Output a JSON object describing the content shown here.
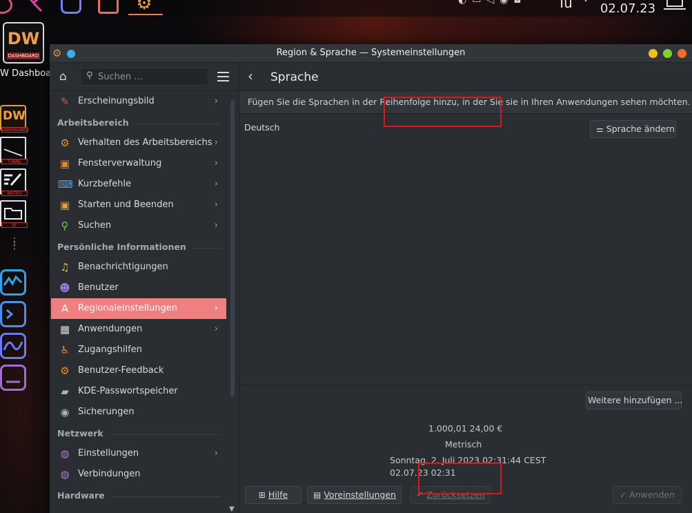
{
  "desktop": {
    "clock": "02.07.23",
    "tray_day": "Tu",
    "dw_widget": {
      "logo": "DW",
      "sub": "DASHBOARD",
      "label": "W Dashboa"
    },
    "dock": [
      {
        "name": "DW",
        "caption": "DASHBOARD"
      },
      {
        "name": "mail",
        "caption": "T-MAIL"
      },
      {
        "name": "notes",
        "caption": "NOTES"
      },
      {
        "name": "files",
        "caption": "SF"
      }
    ]
  },
  "window": {
    "title": "Region & Sprache — Systemeinstellungen"
  },
  "sidebar": {
    "search_placeholder": "Suchen ...",
    "items": [
      {
        "label": "Erscheinungsbild",
        "icon": "brush-icon",
        "color": "#e0563c",
        "chevron": true
      },
      {
        "section": "Arbeitsbereich"
      },
      {
        "label": "Verhalten des Arbeitsbereichs",
        "icon": "gear-icon",
        "color": "#e88a2a",
        "chevron": true
      },
      {
        "label": "Fensterverwaltung",
        "icon": "window-icon",
        "color": "#e88a2a",
        "chevron": true
      },
      {
        "label": "Kurzbefehle",
        "icon": "keyboard-icon",
        "color": "#4aa0e8",
        "chevron": true
      },
      {
        "label": "Starten und Beenden",
        "icon": "monitor-icon",
        "color": "#e8a02a",
        "chevron": true
      },
      {
        "label": "Suchen",
        "icon": "magnifier-icon",
        "color": "#7ad03a",
        "chevron": true
      },
      {
        "section": "Persönliche Informationen"
      },
      {
        "label": "Benachrichtigungen",
        "icon": "bell-icon",
        "color": "#f0c020",
        "chevron": false
      },
      {
        "label": "Benutzer",
        "icon": "users-icon",
        "color": "#9a7ae0",
        "chevron": false
      },
      {
        "label": "Regionaleinstellungen",
        "icon": "region-icon",
        "color": "#5ab0f0",
        "chevron": true,
        "active": true
      },
      {
        "label": "Anwendungen",
        "icon": "apps-grid-icon",
        "color": "#d6d8dc",
        "chevron": true
      },
      {
        "label": "Zugangshilfen",
        "icon": "accessibility-icon",
        "color": "#e88a2a",
        "chevron": false
      },
      {
        "label": "Benutzer-Feedback",
        "icon": "feedback-gear-icon",
        "color": "#e88a2a",
        "chevron": false
      },
      {
        "label": "KDE-Passwortspeicher",
        "icon": "wallet-icon",
        "color": "#b0b3b6",
        "chevron": false
      },
      {
        "label": "Sicherungen",
        "icon": "backup-icon",
        "color": "#b0b3b6",
        "chevron": false
      },
      {
        "section": "Netzwerk"
      },
      {
        "label": "Einstellungen",
        "icon": "globe-icon",
        "color": "#b07ae0",
        "chevron": true
      },
      {
        "label": "Verbindungen",
        "icon": "globe-icon",
        "color": "#b07ae0",
        "chevron": false
      },
      {
        "section": "Hardware"
      }
    ]
  },
  "main": {
    "title": "Sprache",
    "description": "Fügen Sie die Sprachen in der Reihenfolge hinzu, in der Sie sie in Ihren Anwendungen sehen möchten.",
    "language": "Deutsch",
    "change_language_label": "Sprache ändern",
    "add_more_label": "Weitere hinzufügen ...",
    "examples": {
      "numbers": "1.000,01  24,00 €",
      "measurement": "Metrisch",
      "datetime_long": "Sonntag, 2. Juli 2023 02:31:44 CEST",
      "datetime_short": "02.07.23 02:31"
    },
    "buttons": {
      "help": "Hilfe",
      "defaults": "Voreinstellungen",
      "reset": "Zurücksetzen",
      "apply": "Anwenden"
    }
  },
  "colors": {
    "accent_active": "#f08080",
    "highlight_box": "#e31414",
    "window_bg": "#2a2e32"
  }
}
